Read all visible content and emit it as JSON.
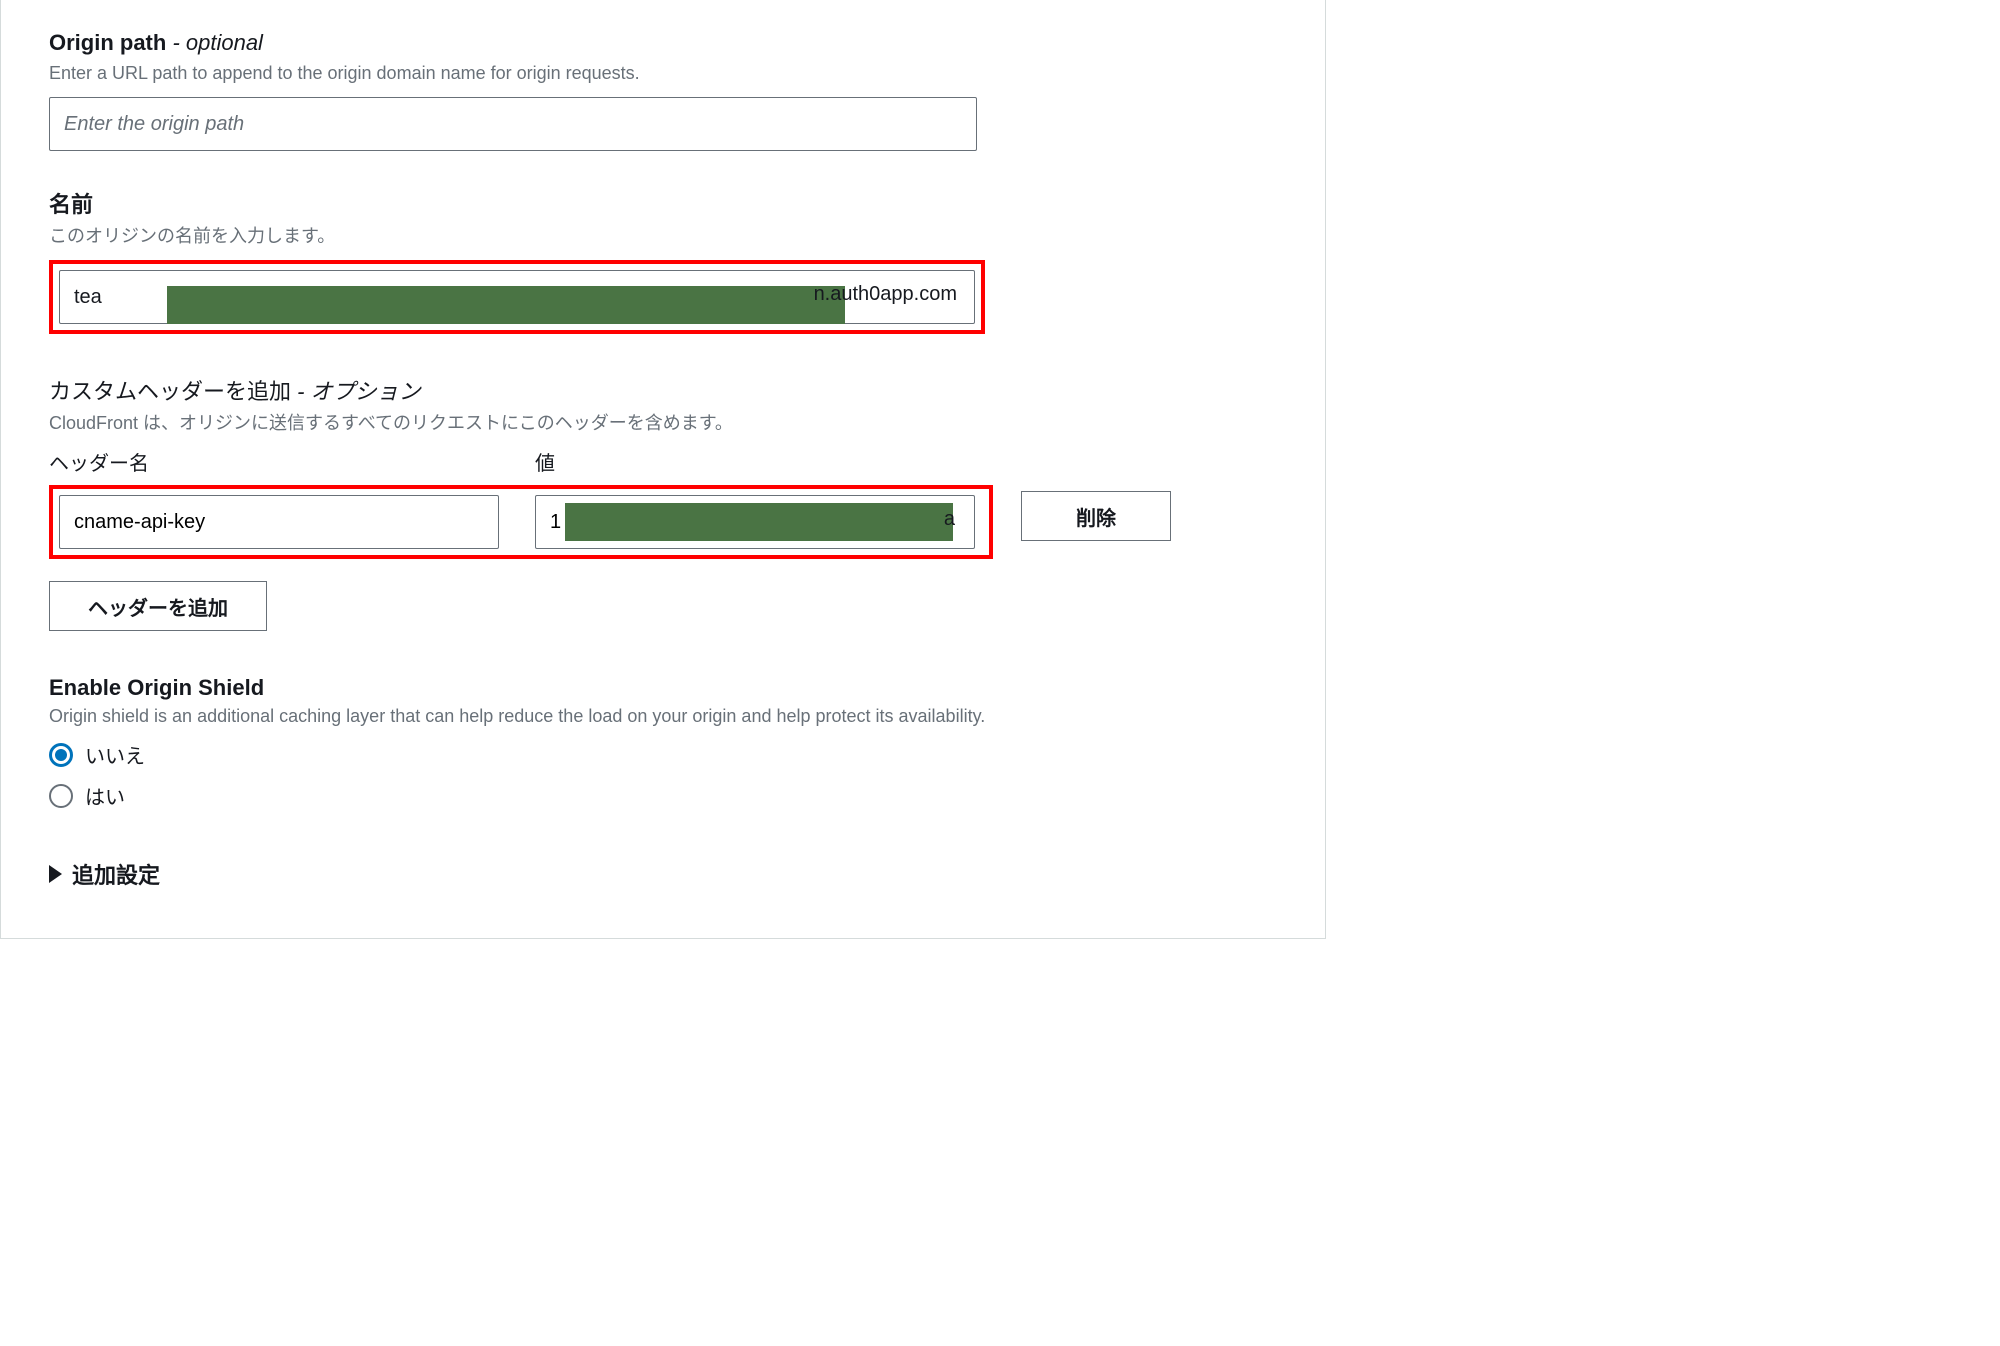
{
  "originPath": {
    "label": "Origin path",
    "optionalSuffix": " - optional",
    "desc": "Enter a URL path to append to the origin domain name for origin requests.",
    "placeholder": "Enter the origin path",
    "value": ""
  },
  "name": {
    "label": "名前",
    "desc": "このオリジンの名前を入力します。",
    "value_prefix": "tea",
    "value_suffix": "n.auth0app.com"
  },
  "customHeader": {
    "label": "カスタムヘッダーを追加",
    "optionalSuffix": " - オプション",
    "desc": "CloudFront は、オリジンに送信するすべてのリクエストにこのヘッダーを含めます。",
    "colName": "ヘッダー名",
    "colValue": "値",
    "headerName": "cname-api-key",
    "headerValue_prefix": "1",
    "headerValue_suffix": "a",
    "deleteBtn": "削除",
    "addBtn": "ヘッダーを追加"
  },
  "originShield": {
    "label": "Enable Origin Shield",
    "desc": "Origin shield is an additional caching layer that can help reduce the load on your origin and help protect its availability.",
    "no": "いいえ",
    "yes": "はい"
  },
  "advanced": {
    "label": "追加設定"
  }
}
